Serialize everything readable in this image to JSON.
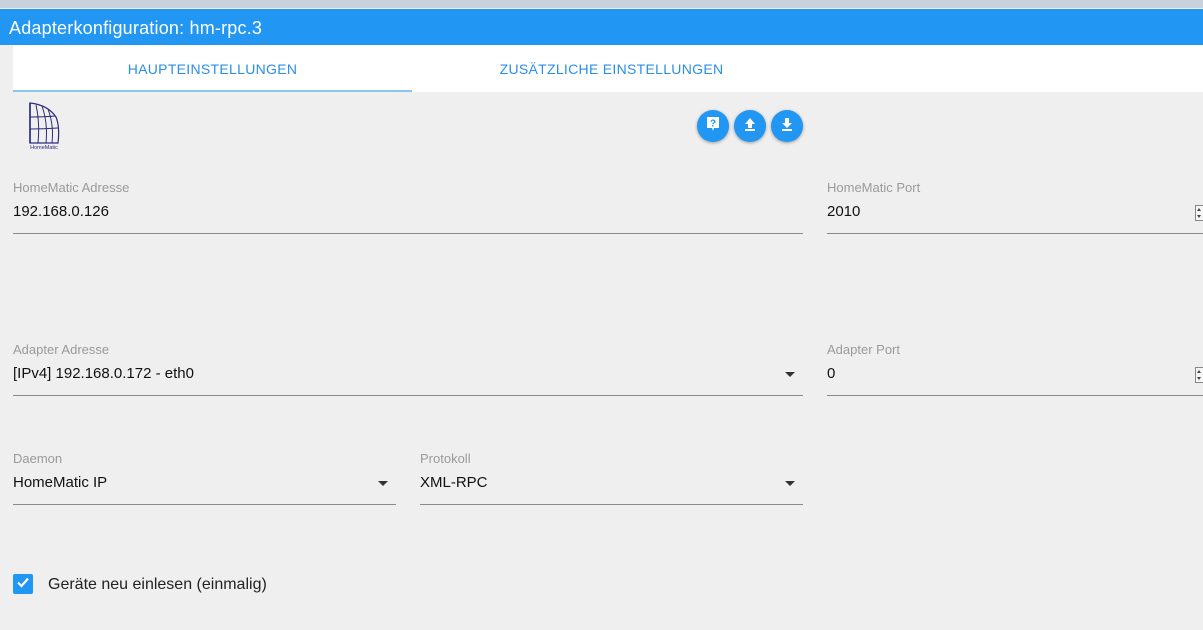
{
  "window": {
    "title": "Adapterkonfiguration: hm-rpc.3"
  },
  "tabs": [
    {
      "label": "HAUPTEINSTELLUNGEN",
      "active": true
    },
    {
      "label": "ZUSÄTZLICHE EINSTELLUNGEN",
      "active": false
    }
  ],
  "logo": {
    "icon": "homematic-logo-icon",
    "text": "HomeMatic"
  },
  "toolbar": {
    "icons": [
      "help-icon",
      "upload-icon",
      "download-icon"
    ]
  },
  "fields": {
    "homematic_address": {
      "label": "HomeMatic Adresse",
      "value": "192.168.0.126"
    },
    "homematic_port": {
      "label": "HomeMatic Port",
      "value": "2010"
    },
    "adapter_address": {
      "label": "Adapter Adresse",
      "value": "[IPv4] 192.168.0.172 - eth0"
    },
    "adapter_port": {
      "label": "Adapter Port",
      "value": "0"
    },
    "daemon": {
      "label": "Daemon",
      "value": "HomeMatic IP"
    },
    "protocol": {
      "label": "Protokoll",
      "value": "XML-RPC"
    }
  },
  "checkbox": {
    "label": "Geräte neu einlesen (einmalig)",
    "checked": true
  },
  "colors": {
    "accent": "#2196f3",
    "background": "#efefef"
  }
}
